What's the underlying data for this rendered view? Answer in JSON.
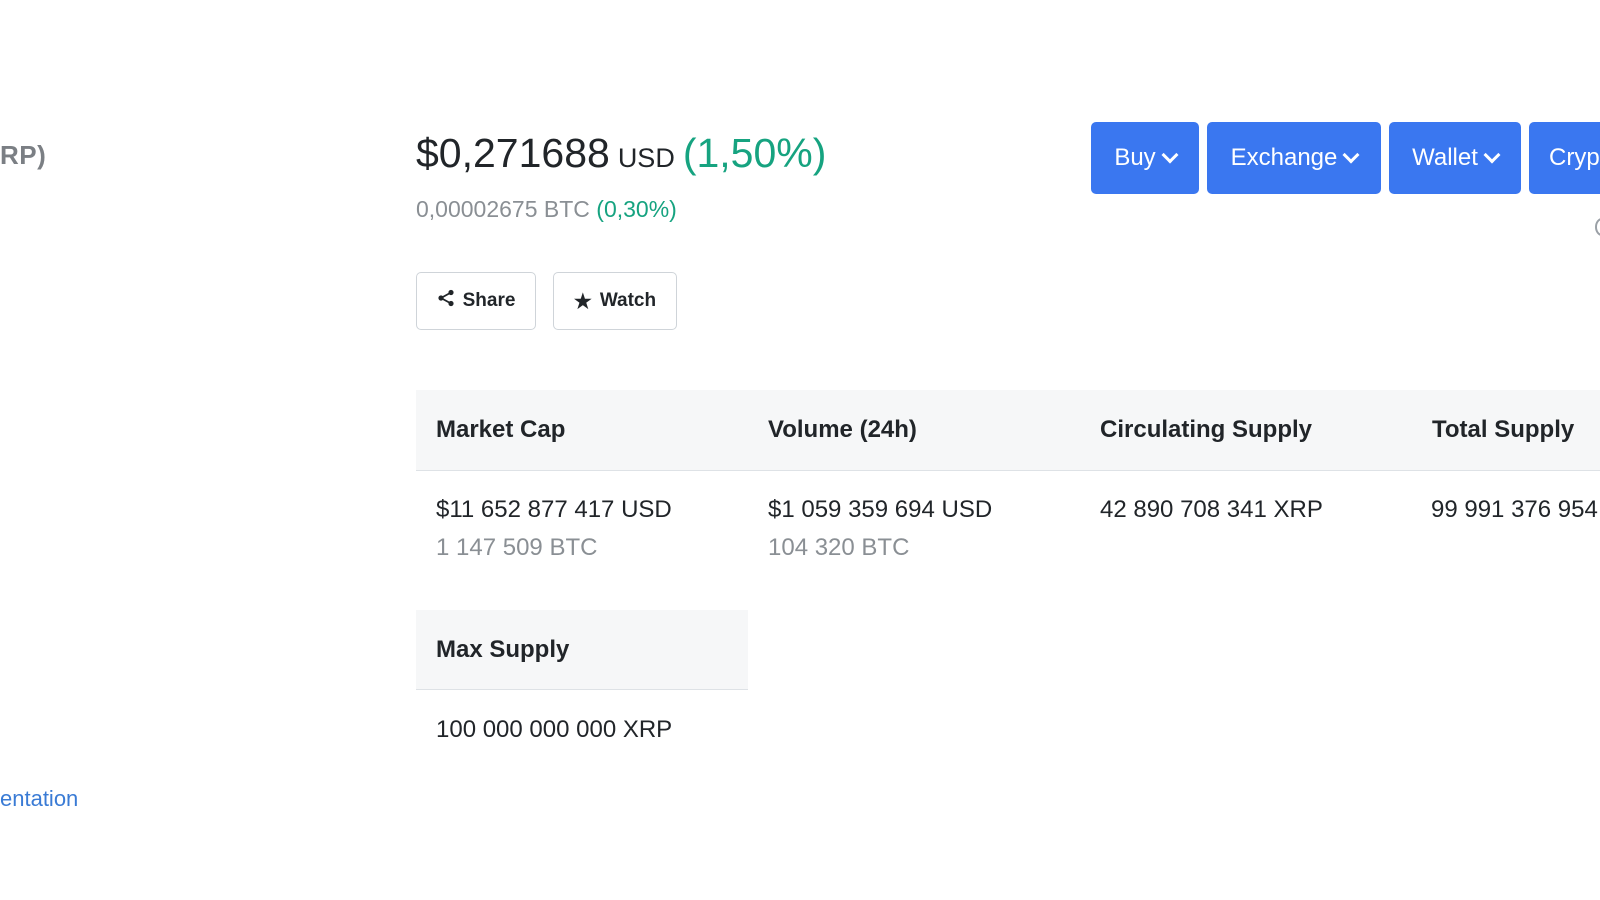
{
  "coin": {
    "title_fragment": "RP)"
  },
  "price": {
    "usd": "$0,271688",
    "usd_currency": "USD",
    "usd_change": "(1,50%)",
    "btc": "0,00002675 BTC",
    "btc_change": "(0,30%)"
  },
  "actions": {
    "share_label": "Share",
    "watch_label": "Watch"
  },
  "menu": {
    "buy": "Buy",
    "exchange": "Exchange",
    "wallet": "Wallet",
    "crypto": "Crypt"
  },
  "stats": {
    "market_cap": {
      "label": "Market Cap",
      "usd": "$11 652 877 417 USD",
      "btc": "1 147 509 BTC"
    },
    "volume": {
      "label": "Volume (24h)",
      "usd": "$1 059 359 694 USD",
      "btc": "104 320 BTC"
    },
    "circulating": {
      "label": "Circulating Supply",
      "value": "42 890 708 341 XRP"
    },
    "total": {
      "label": "Total Supply",
      "value": "99 991 376 954"
    },
    "max": {
      "label": "Max Supply",
      "value": "100 000 000 000 XRP"
    }
  },
  "links": {
    "documentation": "entation"
  },
  "colors": {
    "accent_blue": "#3a77f0",
    "positive_green": "#16a380",
    "muted_gray": "#8a8f94"
  }
}
